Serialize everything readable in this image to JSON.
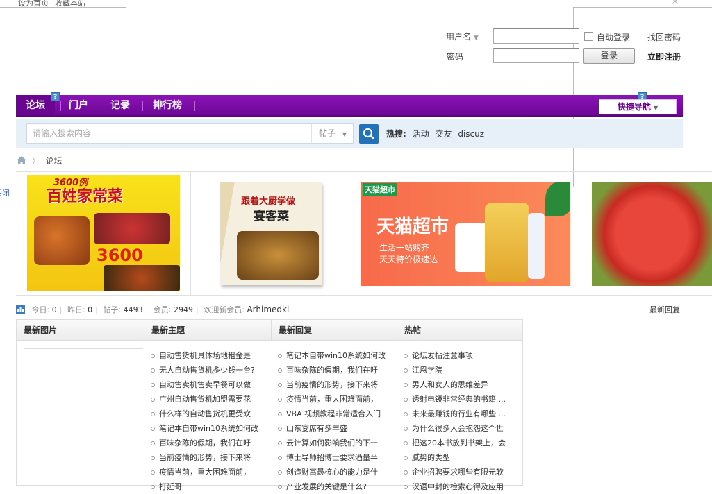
{
  "topbar": {
    "set_home": "设为首页",
    "bookmark": "收藏本站"
  },
  "login": {
    "username_label": "用户名",
    "password_label": "密码",
    "auto_login": "自动登录",
    "find_password": "找回密码",
    "login_button": "登录",
    "register": "立即注册"
  },
  "nav": {
    "items": [
      "论坛",
      "门户",
      "记录",
      "排行榜"
    ],
    "quick_nav": "快捷导航",
    "badge": "?"
  },
  "search": {
    "placeholder": "请输入搜索内容",
    "scope": "帖子",
    "hot_label": "热搜:",
    "hot_terms": [
      "活动",
      "交友",
      "discuz"
    ]
  },
  "breadcrumb": {
    "current": "论坛"
  },
  "ads": {
    "close_left": "关闭",
    "close_right": "关闭",
    "ad1_title": "百姓家常菜",
    "ad1_top": "3600例",
    "ad1_number": "3600",
    "ad2_title": "跟着大厨学做",
    "ad2_sub": "宴客菜",
    "ad3_brand": "天猫超市",
    "ad3_line1": "生活一站购齐",
    "ad3_line2": "天天特价极速达",
    "ad3_logo": "天猫超市"
  },
  "stats": {
    "today_label": "今日:",
    "today": "0",
    "yesterday_label": "昨日:",
    "yesterday": "0",
    "posts_label": "帖子:",
    "posts": "4493",
    "members_label": "会员:",
    "members": "2949",
    "welcome_label": "欢迎新会员:",
    "new_member": "Arhimedkl",
    "latest_reply": "最新回复"
  },
  "columns": {
    "headers": [
      "最新图片",
      "最新主题",
      "最新回复",
      "热帖"
    ],
    "topics": [
      "自动售货机具体场地租金是",
      "无人自动售货机多少钱一台?",
      "自动售卖机售卖早餐可以做",
      "广州自动售货机加盟需要花",
      "什么样的自动售货机更受欢",
      "笔记本自带win10系统如何改",
      "百味杂陈的假期，我们在吁",
      "当前疫情的形势，接下来将",
      "疫情当前，重大困难面前，",
      "打延哥"
    ],
    "replies": [
      "笔记本自带win10系统如何改",
      "百味杂陈的假期，我们在吁",
      "当前疫情的形势，接下来将",
      "疫情当前，重大困难面前，",
      "VBA 视频教程非常适合入门",
      "山东宴席有多丰盛",
      "云计算如何影响我们的下一",
      "博士导师招博士要求酒量半",
      "创造财富最核心的能力是什",
      "产业发展的关键是什么?"
    ],
    "hot": [
      "论坛发帖注意事项",
      "江恩学院",
      "男人和女人的思维差异",
      "透射电镜非常经典的书籍 ...",
      "未来最赚钱的行业有哪些 ...",
      "为什么很多人会抱怨这个世",
      "把这20本书放到书架上，会",
      "膩势的类型",
      "企业招聘要求哪些有限元软",
      "汉语中封的检索心得及应用"
    ]
  },
  "colors": {
    "nav_purple": "#7a0ea6",
    "search_bg": "#e7f0f8",
    "search_btn": "#2272b9"
  }
}
